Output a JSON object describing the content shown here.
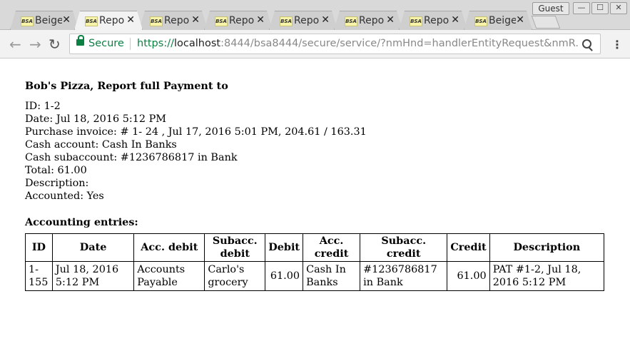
{
  "browser": {
    "tabs": [
      {
        "favicon": "BSA",
        "title": "Beige",
        "active": false
      },
      {
        "favicon": "BSA",
        "title": "Repo",
        "active": true
      },
      {
        "favicon": "BSA",
        "title": "Repo",
        "active": false
      },
      {
        "favicon": "BSA",
        "title": "Repo",
        "active": false
      },
      {
        "favicon": "BSA",
        "title": "Repo",
        "active": false
      },
      {
        "favicon": "BSA",
        "title": "Repo",
        "active": false
      },
      {
        "favicon": "BSA",
        "title": "Repo",
        "active": false
      },
      {
        "favicon": "BSA",
        "title": "Beige",
        "active": false
      }
    ],
    "tab_close": "✕",
    "profile": "Guest",
    "window_controls": {
      "minimize": "—",
      "maximize": "☐",
      "close": "✕"
    },
    "security_label": "Secure",
    "url": {
      "scheme": "https://",
      "host": "localhost",
      "rest": ":8444/bsa8444/secure/service/?nmHnd=handlerEntityRequest&nmR..."
    },
    "icons": {
      "back": "←",
      "forward": "→",
      "reload": "↻",
      "menu": "⋮"
    }
  },
  "report": {
    "heading": "Bob's Pizza, Report full Payment to",
    "lines": [
      "ID: 1-2",
      "Date: Jul 18, 2016 5:12 PM",
      "Purchase invoice: # 1- 24 , Jul 17, 2016 5:01 PM, 204.61 / 163.31",
      "Cash account: Cash In Banks",
      "Cash subaccount: #1236786817 in Bank",
      "Total: 61.00",
      "Description:",
      "Accounted: Yes"
    ],
    "entries_title": "Accounting entries:",
    "table": {
      "headers": [
        "ID",
        "Date",
        "Acc. debit",
        "Subacc. debit",
        "Debit",
        "Acc. credit",
        "Subacc. credit",
        "Credit",
        "Description"
      ],
      "rows": [
        [
          "1-155",
          "Jul 18, 2016 5:12 PM",
          "Accounts Payable",
          "Carlo's grocery",
          "61.00",
          "Cash In Banks",
          "#1236786817 in Bank",
          "61.00",
          "PAT #1-2, Jul 18, 2016 5:12 PM"
        ]
      ]
    }
  }
}
